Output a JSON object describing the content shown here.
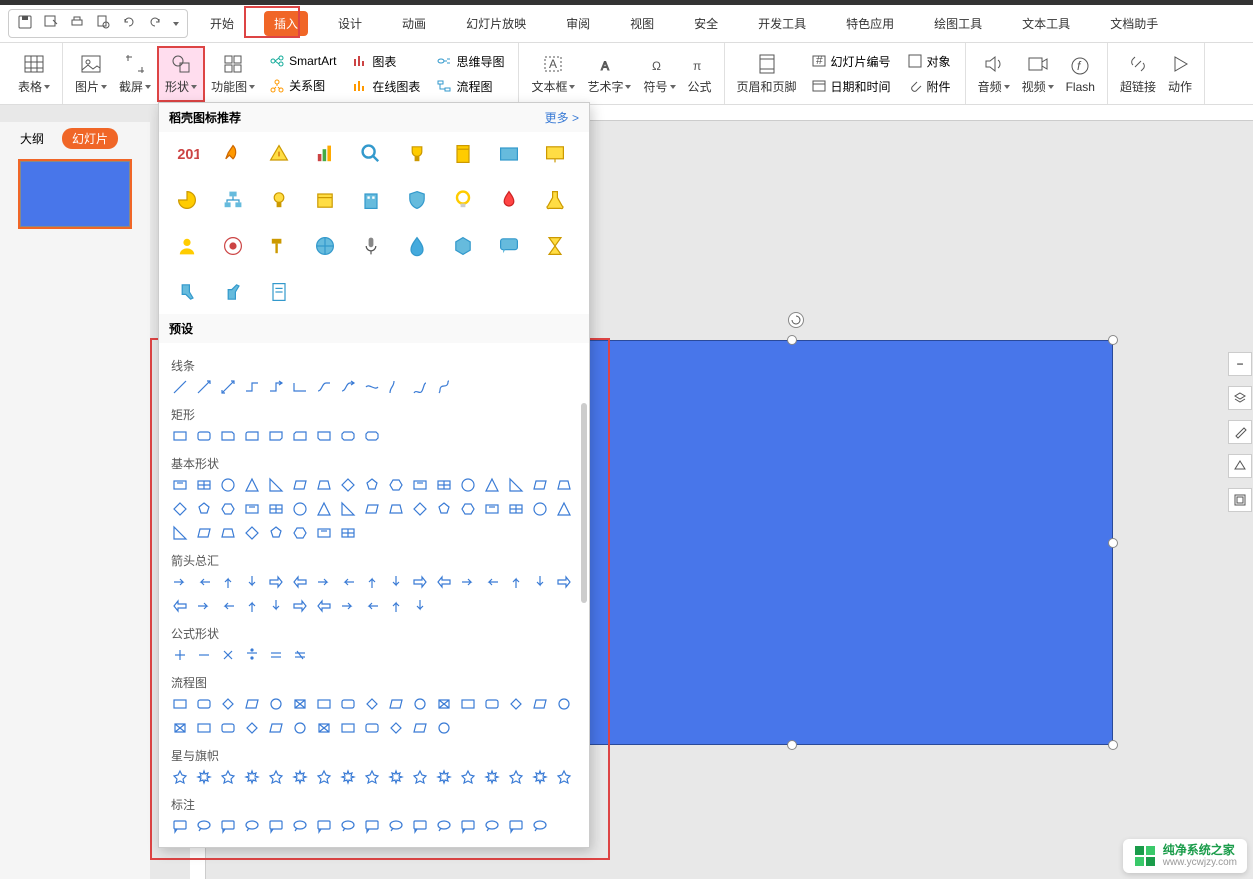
{
  "qat_tooltips": {
    "save": "保存",
    "save_as": "另存",
    "print": "打印",
    "preview": "打印预览",
    "undo": "撤销",
    "redo": "重做",
    "more": "更多"
  },
  "tabs": [
    "开始",
    "插入",
    "设计",
    "动画",
    "幻灯片放映",
    "审阅",
    "视图",
    "安全",
    "开发工具",
    "特色应用",
    "绘图工具",
    "文本工具",
    "文档助手"
  ],
  "active_tab": "插入",
  "ribbon": {
    "table": "表格",
    "picture": "图片",
    "screenshot": "截屏",
    "shapes": "形状",
    "smartgraphic": "功能图",
    "smartart": "SmartArt",
    "chart": "图表",
    "mindmap": "思维导图",
    "relation": "关系图",
    "onlinechart": "在线图表",
    "flowchart": "流程图",
    "textbox": "文本框",
    "wordart": "艺术字",
    "symbol": "符号",
    "equation": "公式",
    "headerfooter": "页眉和页脚",
    "slidenum": "幻灯片编号",
    "datetime": "日期和时间",
    "object": "对象",
    "attachment": "附件",
    "audio": "音频",
    "video": "视频",
    "flash": "Flash",
    "hyperlink": "超链接",
    "action": "动作"
  },
  "sidepane": {
    "outline": "大纲",
    "slides": "幻灯片"
  },
  "shapes_panel": {
    "rec_header": "稻壳图标推荐",
    "more": "更多 >",
    "presets": "预设",
    "cats": {
      "lines": "线条",
      "rects": "矩形",
      "basic": "基本形状",
      "arrows": "箭头总汇",
      "equation": "公式形状",
      "flowchart": "流程图",
      "stars": "星与旗帜",
      "callouts": "标注"
    }
  },
  "rec_icons": [
    "2019",
    "rocket",
    "warning",
    "bar-chart",
    "magnify",
    "trophy",
    "notebook",
    "card",
    "board",
    "pie",
    "org",
    "bulb-trophy",
    "calendar",
    "building",
    "shield",
    "idea",
    "fire",
    "flask",
    "person",
    "target",
    "hammer",
    "globe",
    "mic",
    "drop",
    "hex",
    "chat",
    "hourglass",
    "thumb-down",
    "thumb-up",
    "doc"
  ],
  "counts": {
    "lines": 12,
    "rects": 9,
    "basic": 42,
    "arrows": 28,
    "equation": 6,
    "flowchart": 29,
    "stars": 17,
    "callouts": 16
  },
  "watermark": {
    "t1": "纯净系统之家",
    "t2": "www.ycwjzy.com"
  }
}
